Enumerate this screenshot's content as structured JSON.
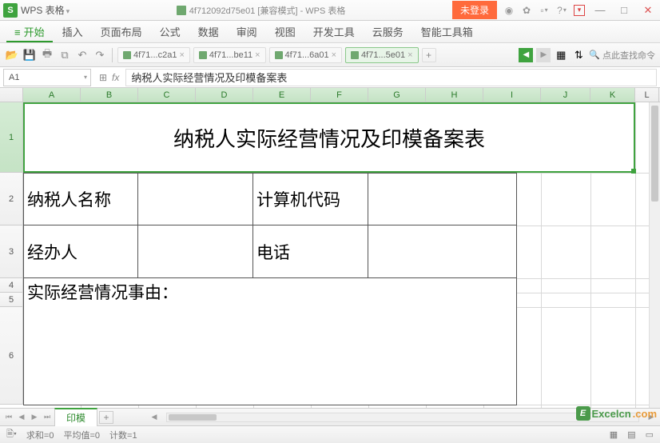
{
  "titlebar": {
    "app_badge": "S",
    "app_name": "WPS 表格",
    "doc_title": "4f712092d75e01 [兼容模式] - WPS 表格",
    "login": "未登录"
  },
  "menu": {
    "items": [
      "开始",
      "插入",
      "页面布局",
      "公式",
      "数据",
      "审阅",
      "视图",
      "开发工具",
      "云服务",
      "智能工具箱"
    ]
  },
  "toolbar": {
    "doc_tabs": [
      {
        "label": "4f71...c2a1"
      },
      {
        "label": "4f71...be11"
      },
      {
        "label": "4f71...6a01"
      },
      {
        "label": "4f71...5e01"
      }
    ],
    "search_hint": "点此查找命令"
  },
  "formula": {
    "cell_ref": "A1",
    "content": "纳税人实际经营情况及印模备案表"
  },
  "grid": {
    "cols": [
      "A",
      "B",
      "C",
      "D",
      "E",
      "F",
      "G",
      "H",
      "I",
      "J",
      "K",
      "L"
    ],
    "rows": [
      "1",
      "2",
      "3",
      "4",
      "5",
      "6"
    ],
    "title": "纳税人实际经营情况及印模备案表",
    "r2a": "纳税人名称",
    "r2e": "计算机代码",
    "r3a": "经办人",
    "r3e": "电话",
    "r4a": "实际经营情况事由："
  },
  "sheet_tabs": {
    "active": "印模"
  },
  "status": {
    "sum": "求和=0",
    "avg": "平均值=0",
    "count": "计数=1"
  },
  "watermark": {
    "badge": "E",
    "text": "Excelcn",
    "com": ".com"
  }
}
